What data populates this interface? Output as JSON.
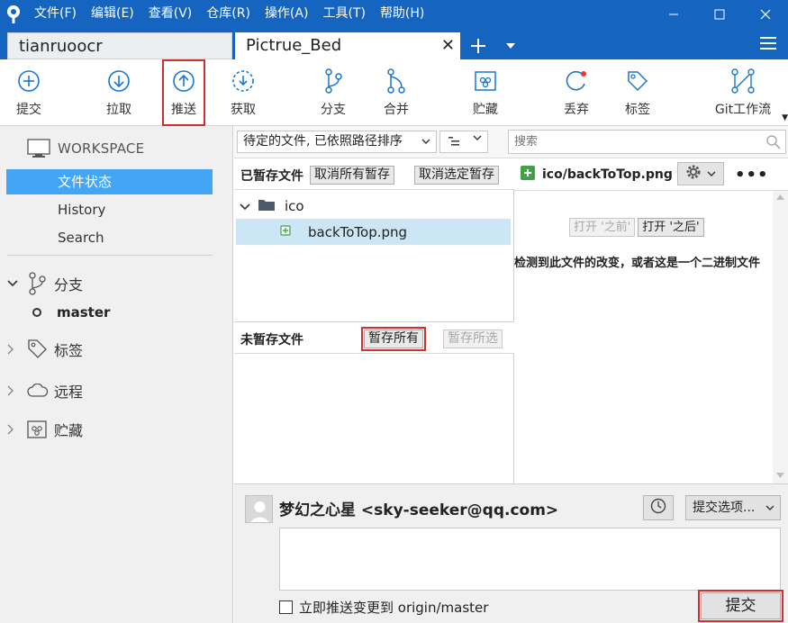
{
  "menu": [
    "文件(F)",
    "编辑(E)",
    "查看(V)",
    "仓库(R)",
    "操作(A)",
    "工具(T)",
    "帮助(H)"
  ],
  "tabs": [
    {
      "label": "tianruoocr",
      "active": false
    },
    {
      "label": "Pictrue_Bed",
      "active": true
    }
  ],
  "toolbar": [
    {
      "label": "提交",
      "icon": "plus-circle-icon"
    },
    {
      "label": "拉取",
      "icon": "arrow-down-circle-icon"
    },
    {
      "label": "推送",
      "icon": "arrow-up-circle-icon",
      "highlighted": true
    },
    {
      "label": "获取",
      "icon": "fetch-dashed-circle-icon"
    },
    {
      "label": "分支",
      "icon": "branch-icon"
    },
    {
      "label": "合并",
      "icon": "merge-icon"
    },
    {
      "label": "贮藏",
      "icon": "stash-icon"
    },
    {
      "label": "丢弃",
      "icon": "discard-icon"
    },
    {
      "label": "标签",
      "icon": "tag-icon"
    },
    {
      "label": "Git工作流",
      "icon": "git-flow-icon"
    }
  ],
  "sidebar": {
    "workspace_label": "WORKSPACE",
    "workspace_items": [
      "文件状态",
      "History",
      "Search"
    ],
    "groups": {
      "branches": "分支",
      "tags": "标签",
      "remotes": "远程",
      "stashes": "贮藏"
    },
    "current_branch": "master"
  },
  "filter": {
    "sort_label": "待定的文件, 已依照路径排序",
    "search_placeholder": "搜索"
  },
  "staged": {
    "title": "已暂存文件",
    "unstage_all": "取消所有暂存",
    "unstage_selected": "取消选定暂存",
    "folder": "ico",
    "file": "backToTop.png"
  },
  "unstaged": {
    "title": "未暂存文件",
    "stage_all": "暂存所有",
    "stage_selected": "暂存所选"
  },
  "diff": {
    "file_path": "ico/backToTop.png",
    "open_before": "打开 '之前'",
    "open_after": "打开 '之后'",
    "message": "检测到此文件的改变，或者这是一个二进制文件"
  },
  "commit": {
    "author": "梦幻之心星 <sky-seeker@qq.com>",
    "options_label": "提交选项...",
    "message_value": "",
    "push_checkbox_label": "立即推送变更到 origin/master",
    "push_checked": false,
    "commit_button": "提交"
  },
  "colors": {
    "titlebar": "#1565c0",
    "selection": "#42a5f5",
    "file_row": "#cde6f6",
    "highlight": "#d32f2f",
    "added_badge": "#43a047"
  }
}
